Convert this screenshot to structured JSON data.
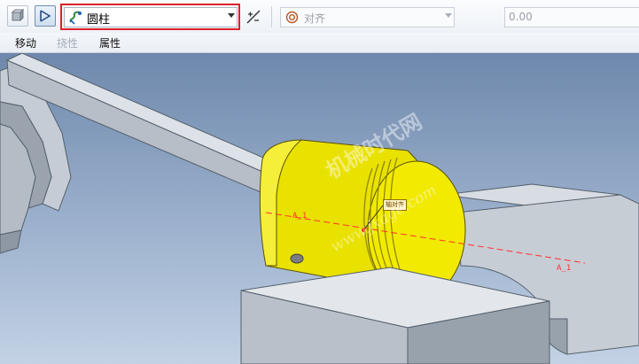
{
  "toolbar": {
    "constraint_type": "圆柱",
    "alignment_type": "对齐",
    "offset_value": "0.00"
  },
  "tabs": [
    {
      "label": "移动",
      "enabled": true
    },
    {
      "label": "挠性",
      "enabled": false
    },
    {
      "label": "属性",
      "enabled": true
    }
  ],
  "viewport": {
    "datum_axis_1": "A_1",
    "datum_axis_2": "A_1",
    "axis_callout": "轴对齐",
    "watermark_cn": "机械时代网",
    "watermark_en": "www.jxage.com"
  },
  "colors": {
    "piston": "#f2ea00",
    "highlight_border": "#e0202a",
    "datum_axis": "#ff3030"
  },
  "icons": {
    "view_button": "box-icon",
    "connection_button": "pin-connection-icon",
    "constraint": "cylinder-constraint-icon",
    "flip": "flip-icon",
    "align": "align-icon"
  }
}
